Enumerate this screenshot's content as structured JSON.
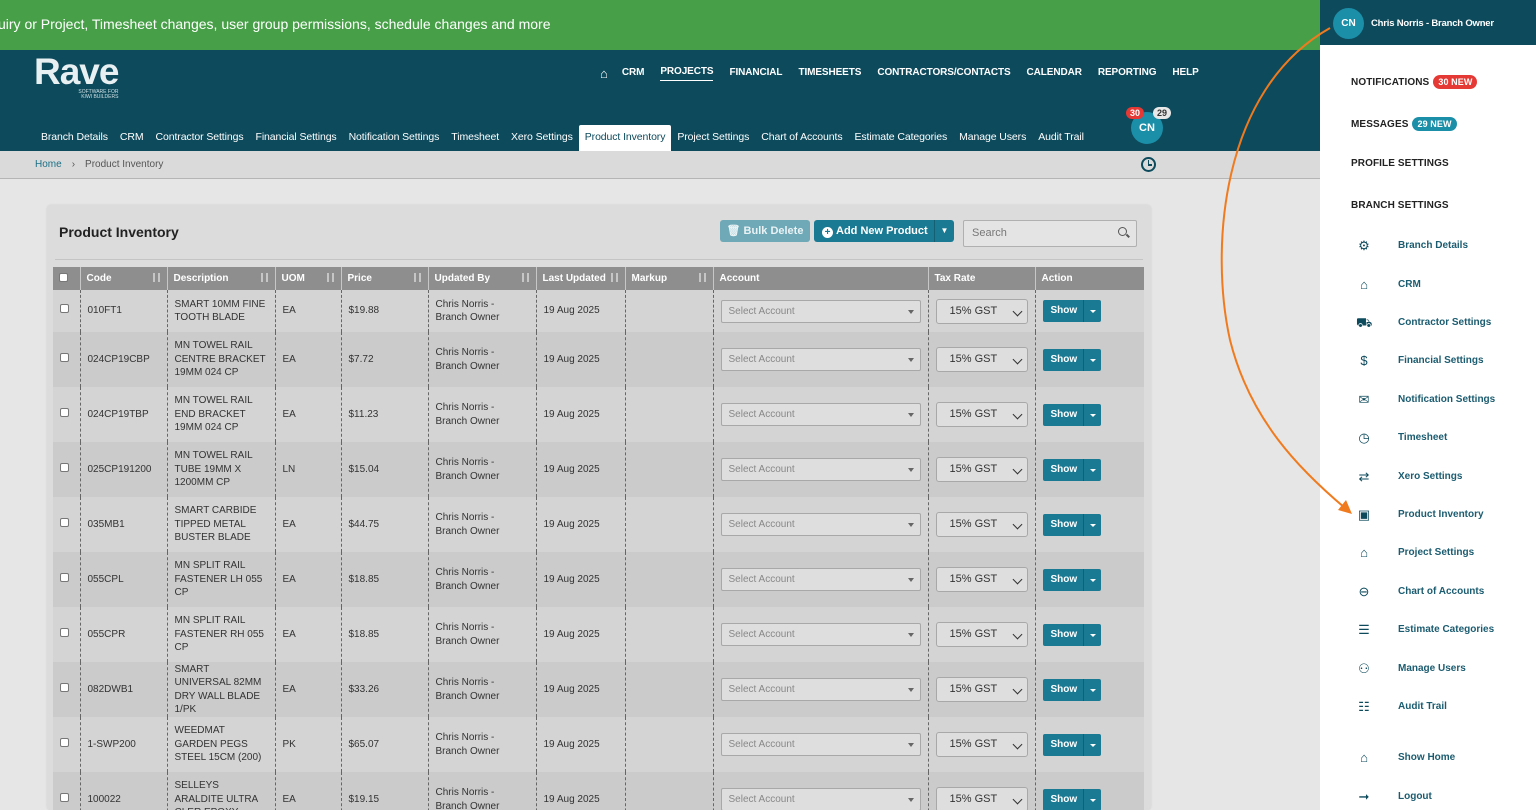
{
  "banner": {
    "text": "uiry or Project, Timesheet changes, user group permissions, schedule changes and more"
  },
  "logo": {
    "word": "Rave",
    "tagline_line1": "SOFTWARE FOR",
    "tagline_line2": "KIWI BUILDERS"
  },
  "main_nav": [
    "CRM",
    "PROJECTS",
    "FINANCIAL",
    "TIMESHEETS",
    "CONTRACTORS/CONTACTS",
    "CALENDAR",
    "REPORTING",
    "HELP"
  ],
  "main_nav_active": "PROJECTS",
  "sub_nav": [
    "Branch Details",
    "CRM",
    "Contractor Settings",
    "Financial Settings",
    "Notification Settings",
    "Timesheet",
    "Xero Settings",
    "Product Inventory",
    "Project Settings",
    "Chart of Accounts",
    "Estimate Categories",
    "Manage Users",
    "Audit Trail"
  ],
  "sub_nav_active": "Product Inventory",
  "header_user": {
    "initials": "CN",
    "notif_count": "30",
    "msg_count": "29"
  },
  "breadcrumb": {
    "home": "Home",
    "current": "Product Inventory"
  },
  "card": {
    "title": "Product Inventory",
    "bulk_delete": "Bulk Delete",
    "add_new": "Add New Product",
    "search_placeholder": "Search"
  },
  "table": {
    "columns": [
      "Code",
      "Description",
      "UOM",
      "Price",
      "Updated By",
      "Last Updated",
      "Markup",
      "Account",
      "Tax Rate",
      "Action"
    ],
    "account_placeholder": "Select Account",
    "action_label": "Show",
    "rows": [
      {
        "code": "010FT1",
        "desc": "SMART 10MM FINE TOOTH BLADE",
        "uom": "EA",
        "price": "$19.88",
        "by": "Chris Norris - Branch Owner",
        "date": "19 Aug 2025",
        "markup": "",
        "tax": "15% GST"
      },
      {
        "code": "024CP19CBP",
        "desc": "MN TOWEL RAIL CENTRE BRACKET 19MM 024 CP",
        "uom": "EA",
        "price": "$7.72",
        "by": "Chris Norris - Branch Owner",
        "date": "19 Aug 2025",
        "markup": "",
        "tax": "15% GST"
      },
      {
        "code": "024CP19TBP",
        "desc": "MN TOWEL RAIL END BRACKET 19MM 024 CP",
        "uom": "EA",
        "price": "$11.23",
        "by": "Chris Norris - Branch Owner",
        "date": "19 Aug 2025",
        "markup": "",
        "tax": "15% GST"
      },
      {
        "code": "025CP191200",
        "desc": "MN TOWEL RAIL TUBE 19MM X 1200MM CP",
        "uom": "LN",
        "price": "$15.04",
        "by": "Chris Norris - Branch Owner",
        "date": "19 Aug 2025",
        "markup": "",
        "tax": "15% GST"
      },
      {
        "code": "035MB1",
        "desc": "SMART CARBIDE TIPPED METAL BUSTER BLADE",
        "uom": "EA",
        "price": "$44.75",
        "by": "Chris Norris - Branch Owner",
        "date": "19 Aug 2025",
        "markup": "",
        "tax": "15% GST"
      },
      {
        "code": "055CPL",
        "desc": "MN SPLIT RAIL FASTENER LH 055 CP",
        "uom": "EA",
        "price": "$18.85",
        "by": "Chris Norris - Branch Owner",
        "date": "19 Aug 2025",
        "markup": "",
        "tax": "15% GST"
      },
      {
        "code": "055CPR",
        "desc": "MN SPLIT RAIL FASTENER RH 055 CP",
        "uom": "EA",
        "price": "$18.85",
        "by": "Chris Norris - Branch Owner",
        "date": "19 Aug 2025",
        "markup": "",
        "tax": "15% GST"
      },
      {
        "code": "082DWB1",
        "desc": "SMART UNIVERSAL 82MM DRY WALL BLADE 1/PK",
        "uom": "EA",
        "price": "$33.26",
        "by": "Chris Norris - Branch Owner",
        "date": "19 Aug 2025",
        "markup": "",
        "tax": "15% GST"
      },
      {
        "code": "1-SWP200",
        "desc": "WEEDMAT GARDEN PEGS STEEL 15CM (200)",
        "uom": "PK",
        "price": "$65.07",
        "by": "Chris Norris - Branch Owner",
        "date": "19 Aug 2025",
        "markup": "",
        "tax": "15% GST"
      },
      {
        "code": "100022",
        "desc": "SELLEYS ARALDITE ULTRA CLER EPOXY",
        "uom": "EA",
        "price": "$19.15",
        "by": "Chris Norris - Branch Owner",
        "date": "19 Aug 2025",
        "markup": "",
        "tax": "15% GST"
      }
    ]
  },
  "panel": {
    "initials": "CN",
    "user": "Chris Norris - Branch Owner",
    "notifications": "NOTIFICATIONS",
    "notifications_badge": "30 NEW",
    "messages": "MESSAGES",
    "messages_badge": "29 NEW",
    "profile": "PROFILE SETTINGS",
    "branch": "BRANCH SETTINGS",
    "items": [
      {
        "label": "Branch Details",
        "icon": "gear-icon"
      },
      {
        "label": "CRM",
        "icon": "crm-icon"
      },
      {
        "label": "Contractor Settings",
        "icon": "truck-icon"
      },
      {
        "label": "Financial Settings",
        "icon": "money-icon"
      },
      {
        "label": "Notification Settings",
        "icon": "envelope-icon"
      },
      {
        "label": "Timesheet",
        "icon": "clock-icon"
      },
      {
        "label": "Xero Settings",
        "icon": "exchange-icon"
      },
      {
        "label": "Product Inventory",
        "icon": "boxes-icon"
      },
      {
        "label": "Project Settings",
        "icon": "home-icon"
      },
      {
        "label": "Chart of Accounts",
        "icon": "search-dollar-icon"
      },
      {
        "label": "Estimate Categories",
        "icon": "list-icon"
      },
      {
        "label": "Manage Users",
        "icon": "users-icon"
      },
      {
        "label": "Audit Trail",
        "icon": "file-search-icon"
      }
    ],
    "show_home": "Show Home",
    "logout": "Logout"
  }
}
